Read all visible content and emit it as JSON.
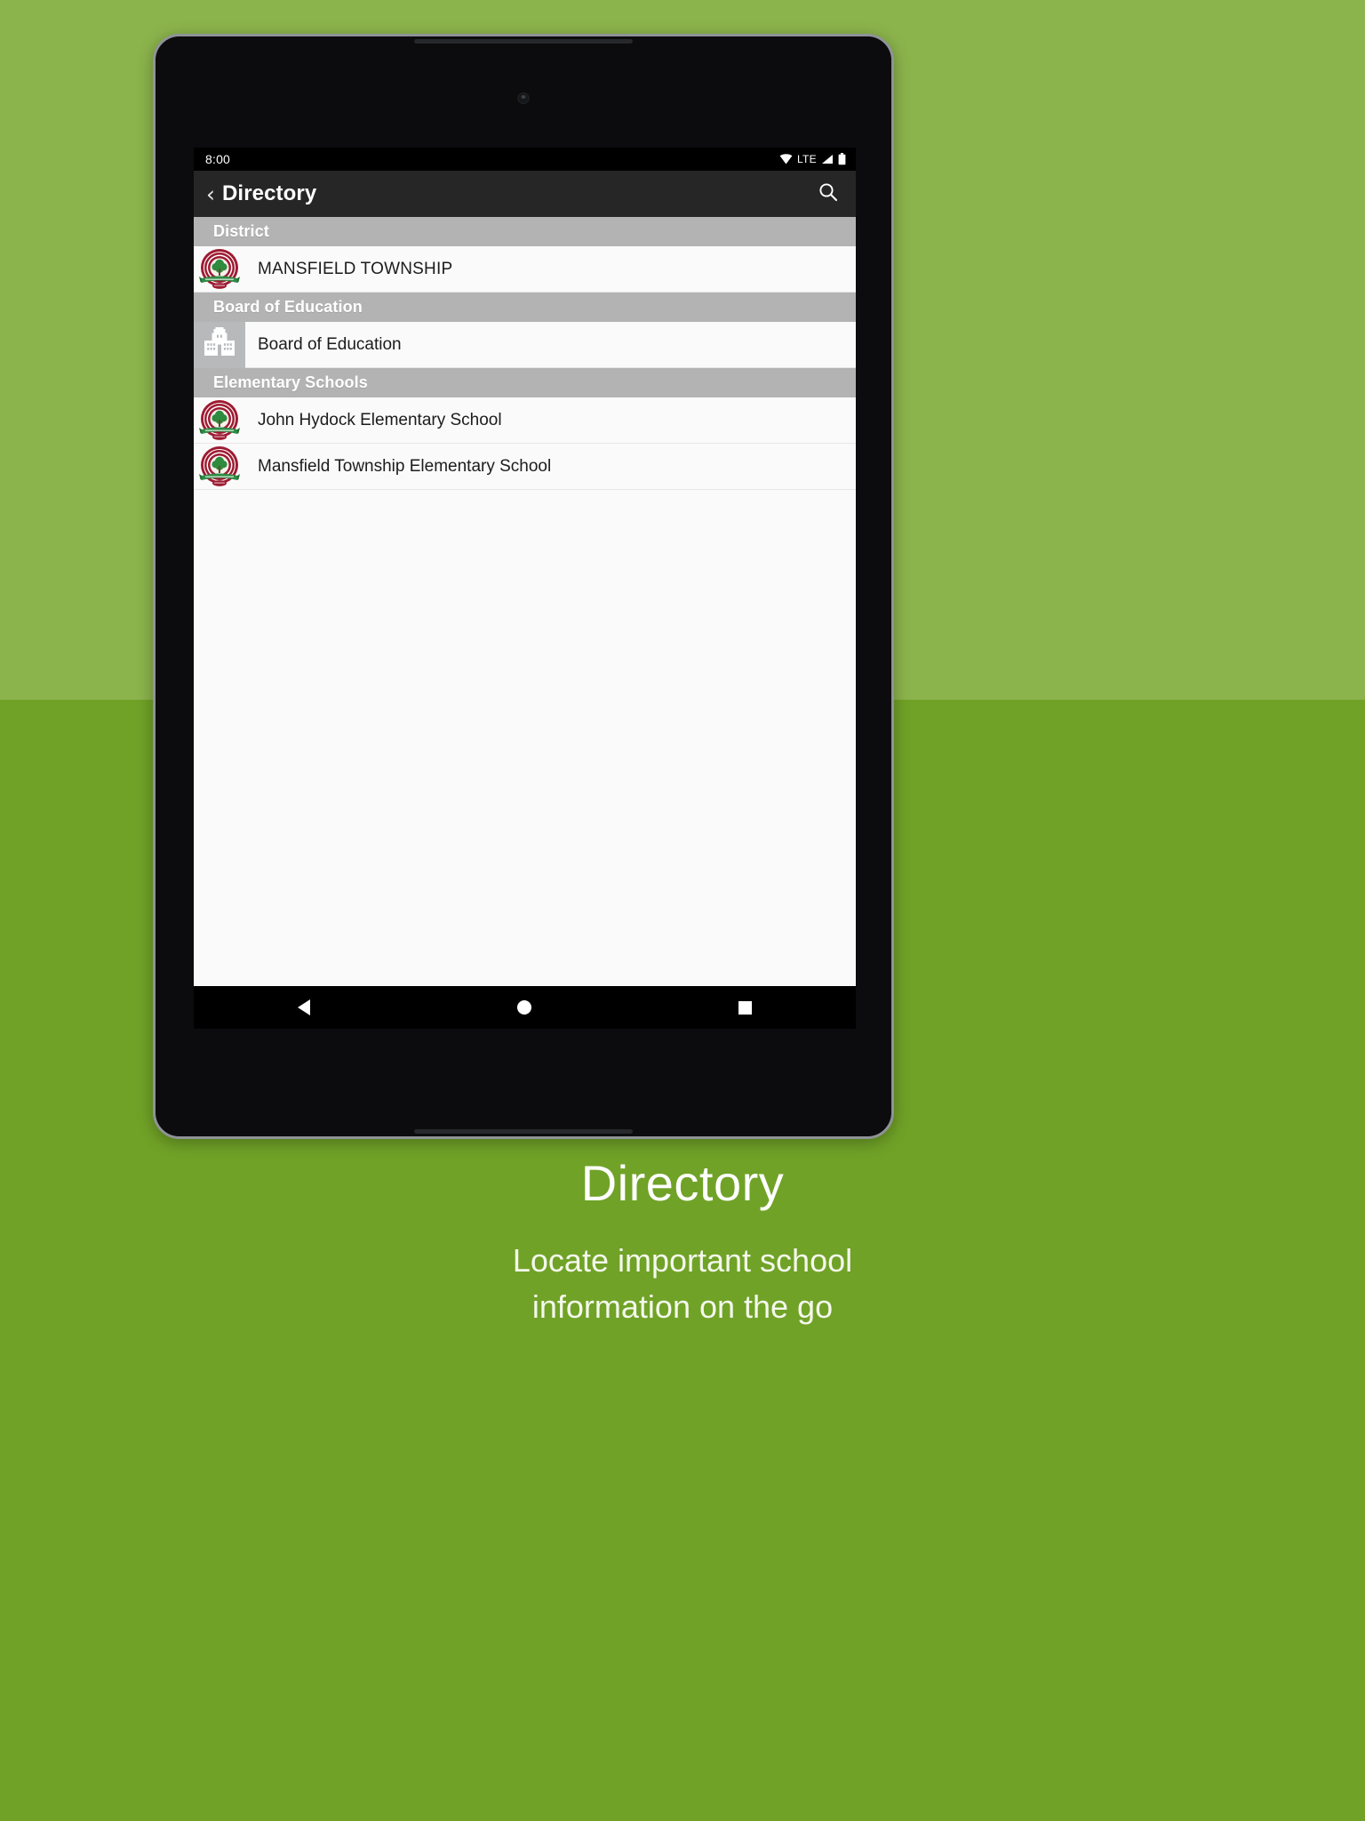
{
  "theme": {
    "bg_top": "#8cb44c",
    "bg_bottom": "#70a227",
    "title_bar": "#262626",
    "section_header": "#b3b3b3",
    "seal_ring": "#9e1b32",
    "seal_tree": "#2f8c3f",
    "seal_banner": "#2e8b45"
  },
  "status_bar": {
    "clock": "8:00",
    "network_label": "LTE",
    "icons": [
      "wifi-icon",
      "signal-icon",
      "battery-icon"
    ]
  },
  "title_bar": {
    "back_chevron": "‹",
    "title": "Directory",
    "search_icon": "search-icon"
  },
  "directory": {
    "sections": [
      {
        "header": "District",
        "rows": [
          {
            "label": "MANSFIELD TOWNSHIP",
            "icon": "district-seal-icon",
            "icon_style": "seal"
          }
        ]
      },
      {
        "header": "Board of Education",
        "rows": [
          {
            "label": "Board of Education",
            "icon": "school-building-icon",
            "icon_style": "building"
          }
        ]
      },
      {
        "header": "Elementary Schools",
        "rows": [
          {
            "label": "John Hydock Elementary School",
            "icon": "district-seal-icon",
            "icon_style": "seal"
          },
          {
            "label": "Mansfield Township Elementary School",
            "icon": "district-seal-icon",
            "icon_style": "seal"
          }
        ]
      }
    ]
  },
  "nav_bar": {
    "back": "back-button",
    "home": "home-button",
    "recents": "recents-button"
  },
  "caption": {
    "title": "Directory",
    "sub_line_1": "Locate important school",
    "sub_line_2": "information on the go"
  }
}
